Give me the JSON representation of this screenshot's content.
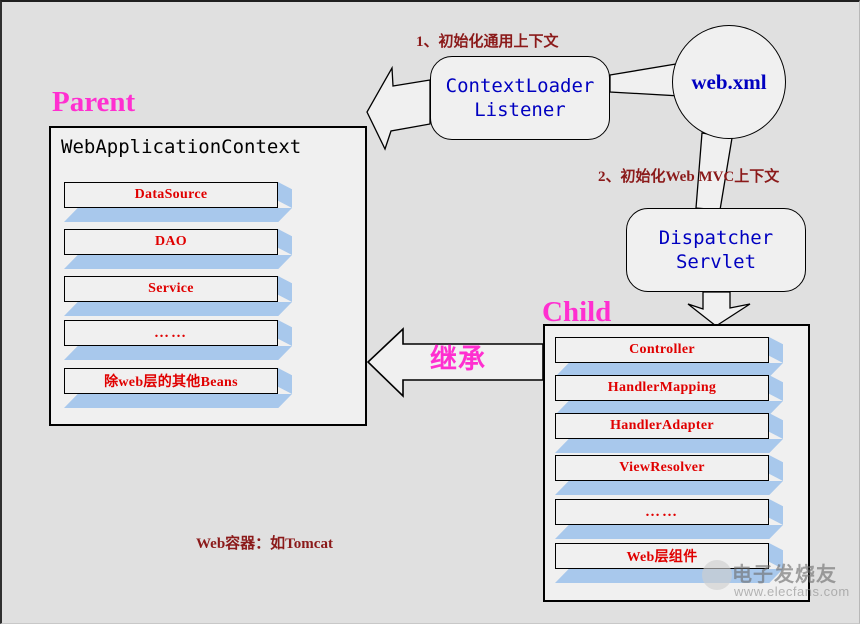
{
  "diagram": {
    "title": "Spring WebApplicationContext Parent / Child Hierarchy",
    "colors": {
      "background": "#e0e0e0",
      "section_title": "#ff2fd0",
      "bean_label": "#e00000",
      "process_label": "#0000c0",
      "annotation": "#8b1a1a",
      "slab_shadow": "#a8c8ec",
      "box_fill": "#f0f0f0",
      "outline": "#000000"
    }
  },
  "parent": {
    "section_title": "Parent",
    "container_label": "WebApplicationContext",
    "beans": [
      {
        "label": "DataSource"
      },
      {
        "label": "DAO"
      },
      {
        "label": "Service"
      },
      {
        "label": "……"
      },
      {
        "label": "除web层的其他Beans"
      }
    ]
  },
  "child": {
    "section_title": "Child",
    "beans": [
      {
        "label": "Controller"
      },
      {
        "label": "HandlerMapping"
      },
      {
        "label": "HandlerAdapter"
      },
      {
        "label": "ViewResolver"
      },
      {
        "label": "……"
      },
      {
        "label": "Web层组件"
      }
    ]
  },
  "nodes": {
    "web_xml": "web.xml",
    "context_loader_listener": "ContextLoader\nListener",
    "dispatcher_servlet": "Dispatcher\nServlet"
  },
  "annotations": {
    "step1": "1、初始化通用上下文",
    "step2": "2、初始化Web MVC上下文",
    "inherit": "继承",
    "web_container": "Web容器：如Tomcat"
  },
  "watermark": {
    "brand": "电子发烧友",
    "url": "www.elecfans.com"
  }
}
